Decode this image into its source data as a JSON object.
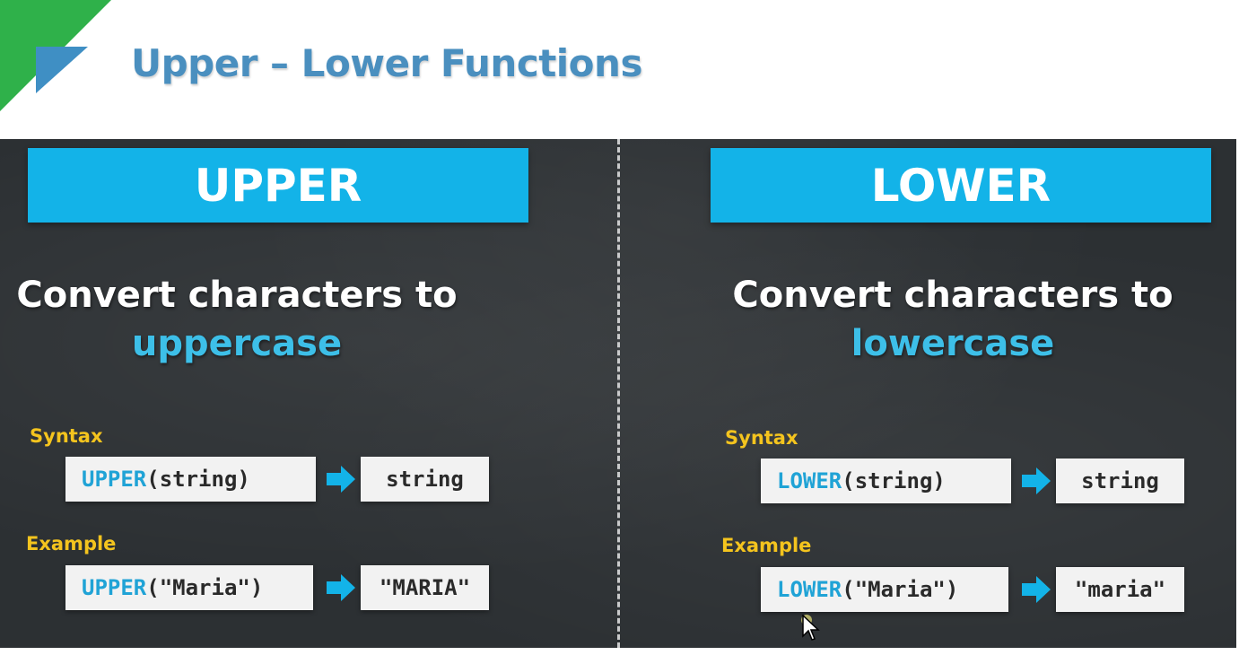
{
  "header": {
    "title": "Upper – Lower Functions"
  },
  "upper": {
    "heading": "UPPER",
    "desc_line1": "Convert characters to",
    "desc_highlight": "uppercase",
    "syntax_label": "Syntax",
    "syntax_fn": "UPPER",
    "syntax_args": "(string)",
    "syntax_result": "string",
    "example_label": "Example",
    "example_fn": "UPPER",
    "example_args": "(\"Maria\")",
    "example_result": "\"MARIA\""
  },
  "lower": {
    "heading": "LOWER",
    "desc_line1": "Convert characters to",
    "desc_highlight": "lowercase",
    "syntax_label": "Syntax",
    "syntax_fn": "LOWER",
    "syntax_args": "(string)",
    "syntax_result": "string",
    "example_label": "Example",
    "example_fn": "LOWER",
    "example_args": "(\"Maria\")",
    "example_result": "\"maria\""
  },
  "colors": {
    "banner": "#13b3e8",
    "highlight": "#3dbfe8",
    "label": "#f4c41e",
    "function": "#20a3d6",
    "board": "#2c3033",
    "title": "#4a8fbf",
    "logo_green": "#2fb14a",
    "logo_blue": "#3f8fc4"
  },
  "icons": {
    "arrow": "right-arrow-icon",
    "cursor": "mouse-pointer-icon"
  }
}
